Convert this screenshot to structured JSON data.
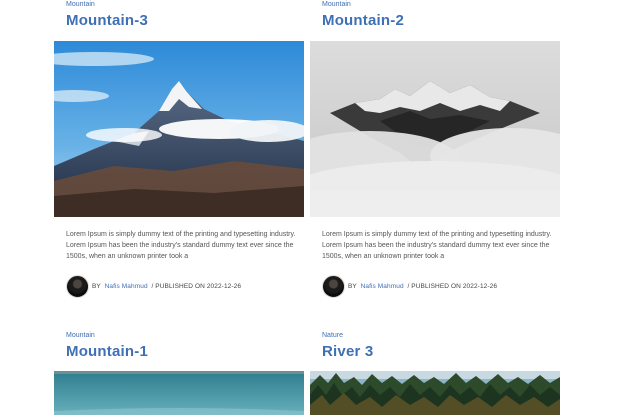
{
  "posts": [
    {
      "category": "Mountain",
      "title": "Mountain-3",
      "excerpt": "Lorem Ipsum is simply dummy text of the printing and typesetting industry. Lorem Ipsum has been the industry's standard dummy text ever since the 1500s, when an unknown printer took a",
      "by": "BY",
      "author": "Nafis Mahmud",
      "published": "/ PUBLISHED ON 2022-12-26",
      "image": "blue sky snowy mountain peak"
    },
    {
      "category": "Mountain",
      "title": "Mountain-2",
      "excerpt": "Lorem Ipsum is simply dummy text of the printing and typesetting industry. Lorem Ipsum has been the industry's standard dummy text ever since the 1500s, when an unknown printer took a",
      "by": "BY",
      "author": "Nafis Mahmud",
      "published": "/ PUBLISHED ON 2022-12-26",
      "image": "mountain peak in clouds black and white"
    },
    {
      "category": "Mountain",
      "title": "Mountain-1",
      "image": "teal sky horizon"
    },
    {
      "category": "Nature",
      "title": "River 3",
      "image": "pine forest"
    }
  ],
  "colors": {
    "accent": "#3f6fb5"
  }
}
